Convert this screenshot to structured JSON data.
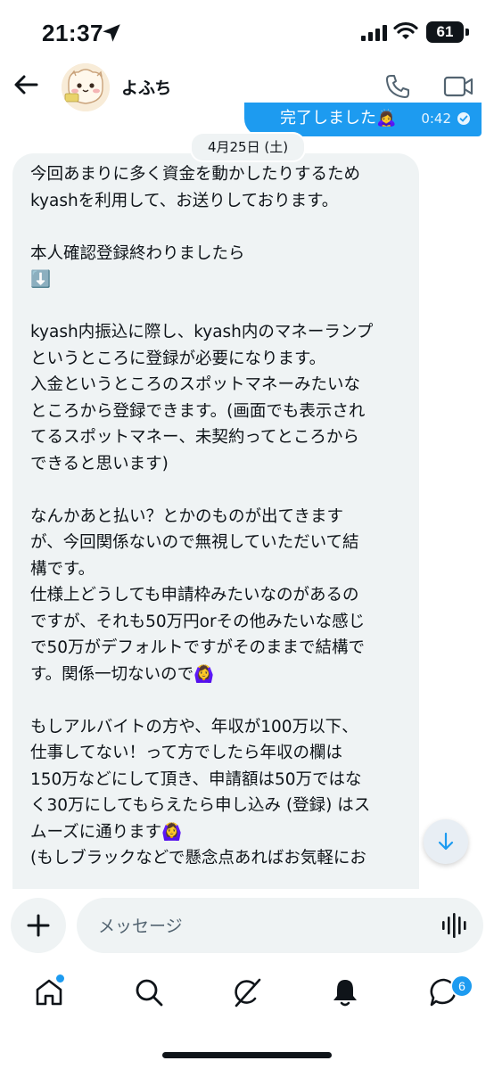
{
  "status_bar": {
    "time": "21:37",
    "battery": "61"
  },
  "header": {
    "contact_name": "よふち"
  },
  "chat": {
    "sent_message": {
      "text": "完了しました🙇‍♀️",
      "time": "0:42"
    },
    "date_divider": "4月25日 (土)",
    "received_message": "今回あまりに多く資金を動かしたりするため\nkyashを利用して、お送りしております。\n\n本人確認登録終わりましたら\n⬇️\n\nkyash内振込に際し、kyash内のマネーランプ\nというところに登録が必要になります。\n入金というところのスポットマネーみたいな\nところから登録できます。(画面でも表示され\nてるスポットマネー、未契約ってところから\nできると思います)\n\nなんかあと払い？とかのものが出てきます\nが、今回関係ないので無視していただいて結\n構です。\n仕様上どうしても申請枠みたいなのがあるの\nですが、それも50万円orその他みたいな感じ\nで50万がデフォルトですがそのままで結構で\nす。関係一切ないので🙆‍♀️\n\nもしアルバイトの方や、年収が100万以下、\n仕事してない！って方でしたら年収の欄は\n150万などにして頂き、申請額は50万ではな\nく30万にしてもらえたら申し込み (登録) はス\nムーズに通ります🙆‍♀️\n(もしブラックなどで懸念点あればお気軽にお"
  },
  "composer": {
    "placeholder": "メッセージ"
  },
  "tab_bar": {
    "items": [
      "home-icon",
      "search-icon",
      "grok-icon",
      "notifications-icon",
      "messages-icon"
    ],
    "messages_badge": "6"
  },
  "colors": {
    "accent": "#1d9bf0",
    "bubble": "#eff3f4",
    "text": "#0f1419",
    "muted": "#536471"
  }
}
